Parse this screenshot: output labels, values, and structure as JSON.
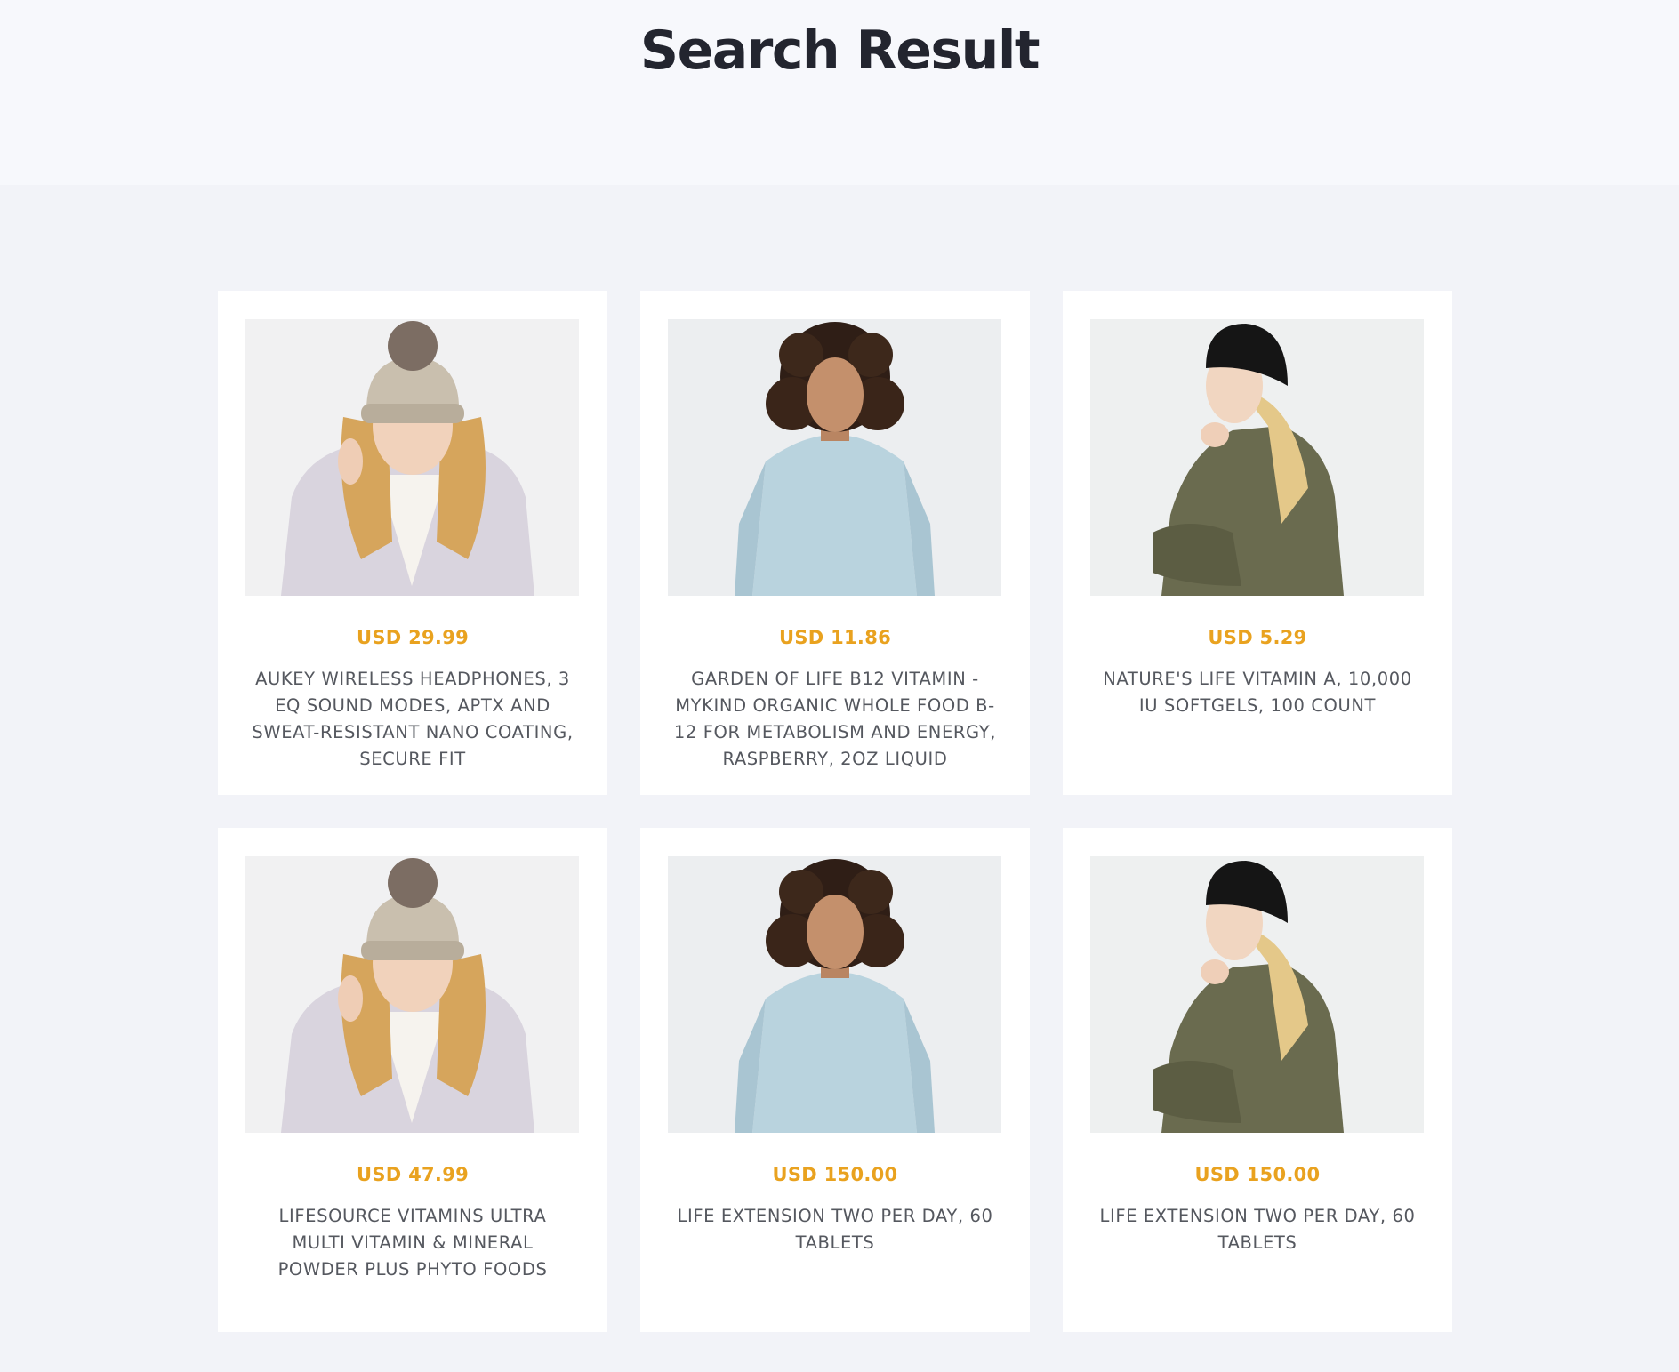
{
  "header": {
    "title": "Search Result"
  },
  "products": [
    {
      "price": "USD 29.99",
      "title": "AUKEY WIRELESS HEADPHONES, 3 EQ SOUND MODES, APTX AND SWEAT-RESISTANT NANO COATING, SECURE FIT",
      "image": "woman-beige-pom-pom-beanie-photo"
    },
    {
      "price": "USD 11.86",
      "title": "GARDEN OF LIFE B12 VITAMIN - MYKIND ORGANIC WHOLE FOOD B-12 FOR METABOLISM AND ENERGY, RASPBERRY, 2OZ LIQUID",
      "image": "woman-curly-hair-blue-sweatshirt-photo"
    },
    {
      "price": "USD 5.29",
      "title": "NATURE'S LIFE VITAMIN A, 10,000 IU SOFTGELS, 100 COUNT",
      "image": "woman-black-beanie-olive-sweater-photo"
    },
    {
      "price": "USD 47.99",
      "title": "LIFESOURCE VITAMINS ULTRA MULTI VITAMIN & MINERAL POWDER PLUS PHYTO FOODS",
      "image": "woman-beige-pom-pom-beanie-photo"
    },
    {
      "price": "USD 150.00",
      "title": "LIFE EXTENSION TWO PER DAY, 60 TABLETS",
      "image": "woman-curly-hair-blue-sweatshirt-photo"
    },
    {
      "price": "USD 150.00",
      "title": "LIFE EXTENSION TWO PER DAY, 60 TABLETS",
      "image": "woman-black-beanie-olive-sweater-photo"
    }
  ],
  "colors": {
    "price": "#e9a21f",
    "title": "#23252f",
    "product_text": "#55585f",
    "page_bg": "#f2f3f8",
    "header_bg": "#f7f8fc"
  }
}
